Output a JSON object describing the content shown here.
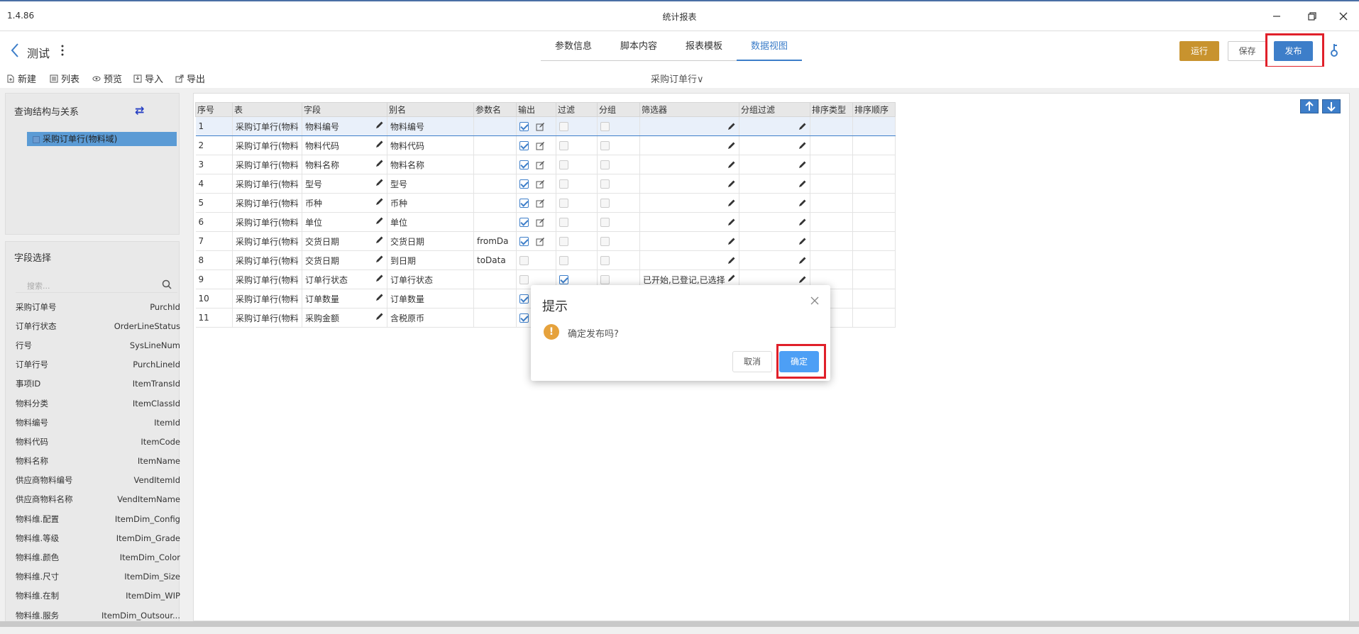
{
  "window": {
    "version": "1.4.86",
    "title": "统计报表"
  },
  "header": {
    "page_title": "测试",
    "tabs": [
      {
        "label": "参数信息",
        "active": false
      },
      {
        "label": "脚本内容",
        "active": false
      },
      {
        "label": "报表模板",
        "active": false
      },
      {
        "label": "数据视图",
        "active": true
      }
    ],
    "run_label": "运行",
    "save_label": "保存",
    "publish_label": "发布"
  },
  "toolbar": {
    "new_label": "新建",
    "list_label": "列表",
    "preview_label": "预览",
    "import_label": "导入",
    "export_label": "导出",
    "datasource": "采购订单行∨"
  },
  "query_panel": {
    "title": "查询结构与关系",
    "tree_item": "采购订单行(物料域)"
  },
  "field_panel": {
    "title": "字段选择",
    "search_placeholder": "搜索...",
    "fields": [
      {
        "name": "采购订单号",
        "code": "PurchId"
      },
      {
        "name": "订单行状态",
        "code": "OrderLineStatus"
      },
      {
        "name": "行号",
        "code": "SysLineNum"
      },
      {
        "name": "订单行号",
        "code": "PurchLineId"
      },
      {
        "name": "事项ID",
        "code": "ItemTransId"
      },
      {
        "name": "物料分类",
        "code": "ItemClassId"
      },
      {
        "name": "物料编号",
        "code": "ItemId"
      },
      {
        "name": "物料代码",
        "code": "ItemCode"
      },
      {
        "name": "物料名称",
        "code": "ItemName"
      },
      {
        "name": "供应商物料编号",
        "code": "VendItemId"
      },
      {
        "name": "供应商物料名称",
        "code": "VendItemName"
      },
      {
        "name": "物料维.配置",
        "code": "ItemDim_Config"
      },
      {
        "name": "物料维.等级",
        "code": "ItemDim_Grade"
      },
      {
        "name": "物料维.颜色",
        "code": "ItemDim_Color"
      },
      {
        "name": "物料维.尺寸",
        "code": "ItemDim_Size"
      },
      {
        "name": "物料维.在制",
        "code": "ItemDim_WIP"
      },
      {
        "name": "物料维.服务",
        "code": "ItemDim_Outsour..."
      }
    ]
  },
  "grid": {
    "columns": [
      "序号",
      "表",
      "字段",
      "别名",
      "参数名",
      "输出",
      "过滤",
      "分组",
      "筛选器",
      "分组过滤",
      "排序类型",
      "排序顺序"
    ],
    "rows": [
      {
        "no": "1",
        "table": "采购订单行(物料",
        "field": "物料编号",
        "alias": "物料编号",
        "param": "",
        "output": true,
        "filter": false,
        "group": false,
        "filter_value": ""
      },
      {
        "no": "2",
        "table": "采购订单行(物料",
        "field": "物料代码",
        "alias": "物料代码",
        "param": "",
        "output": true,
        "filter": false,
        "group": false,
        "filter_value": ""
      },
      {
        "no": "3",
        "table": "采购订单行(物料",
        "field": "物料名称",
        "alias": "物料名称",
        "param": "",
        "output": true,
        "filter": false,
        "group": false,
        "filter_value": ""
      },
      {
        "no": "4",
        "table": "采购订单行(物料",
        "field": "型号",
        "alias": "型号",
        "param": "",
        "output": true,
        "filter": false,
        "group": false,
        "filter_value": ""
      },
      {
        "no": "5",
        "table": "采购订单行(物料",
        "field": "币种",
        "alias": "币种",
        "param": "",
        "output": true,
        "filter": false,
        "group": false,
        "filter_value": ""
      },
      {
        "no": "6",
        "table": "采购订单行(物料",
        "field": "单位",
        "alias": "单位",
        "param": "",
        "output": true,
        "filter": false,
        "group": false,
        "filter_value": ""
      },
      {
        "no": "7",
        "table": "采购订单行(物料",
        "field": "交货日期",
        "alias": "交货日期",
        "param": "fromDa",
        "output": true,
        "filter": false,
        "group": false,
        "filter_value": ""
      },
      {
        "no": "8",
        "table": "采购订单行(物料",
        "field": "交货日期",
        "alias": "到日期",
        "param": "toData",
        "output": false,
        "filter": false,
        "group": false,
        "filter_value": ""
      },
      {
        "no": "9",
        "table": "采购订单行(物料",
        "field": "订单行状态",
        "alias": "订单行状态",
        "param": "",
        "output": false,
        "filter": true,
        "group": false,
        "filter_value": "已开始,已登记,已选择"
      },
      {
        "no": "10",
        "table": "采购订单行(物料",
        "field": "订单数量",
        "alias": "订单数量",
        "param": "",
        "output": true,
        "filter": false,
        "group": false,
        "filter_value": ""
      },
      {
        "no": "11",
        "table": "采购订单行(物料",
        "field": "采购金额",
        "alias": "含税原币",
        "param": "",
        "output": true,
        "filter": false,
        "group": false,
        "filter_value": ""
      }
    ]
  },
  "dialog": {
    "title": "提示",
    "message": "确定发布吗?",
    "cancel_label": "取消",
    "ok_label": "确定"
  }
}
